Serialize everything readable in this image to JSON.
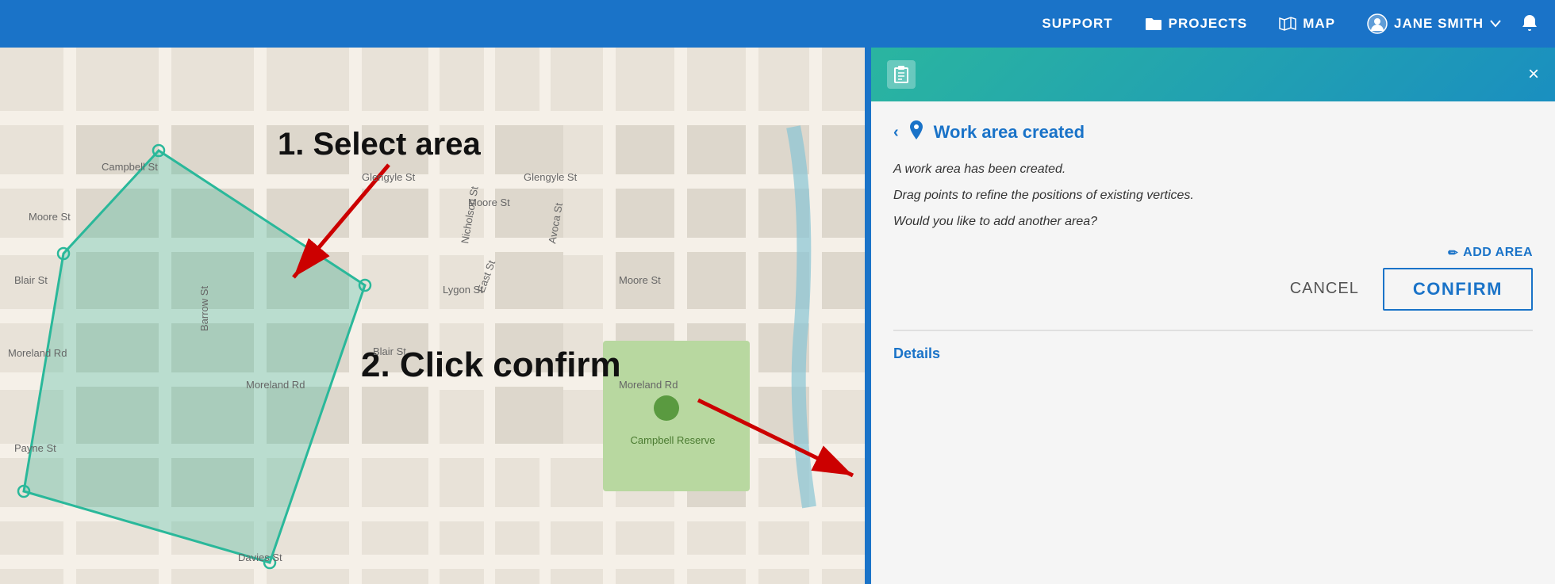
{
  "topnav": {
    "support_label": "SUPPORT",
    "projects_label": "PROJECTS",
    "map_label": "MAP",
    "user_label": "JANE SMITH"
  },
  "panel": {
    "close_label": "×",
    "back_label": "‹",
    "title": "Work area created",
    "desc1": "A work area has been created.",
    "desc2": "Drag points to refine the positions of existing vertices.",
    "desc3": "Would you like to add another area?",
    "add_area_label": "ADD AREA",
    "cancel_label": "CANCEL",
    "confirm_label": "CONFIRM",
    "details_label": "Details"
  },
  "map": {
    "annotation1": "1. Select area",
    "annotation2": "2. Click confirm",
    "streets": [
      "Campbell St",
      "Moore St",
      "Blair St",
      "Moreland Rd",
      "Barrow St",
      "Glengyle St",
      "Lygon St",
      "East St",
      "Nicholson St",
      "Avoca St",
      "Davies St",
      "Payne St",
      "Glengyle St",
      "Moore St",
      "Moore St",
      "Moreland Rd"
    ]
  }
}
